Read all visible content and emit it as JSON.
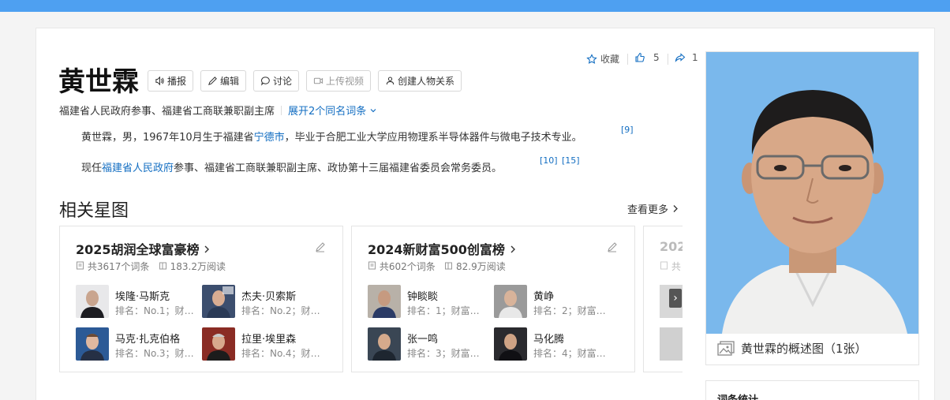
{
  "header": {
    "name": "黄世霖",
    "buttons": {
      "broadcast": "播报",
      "edit": "编辑",
      "discuss": "讨论",
      "upload_video": "上传视频",
      "create_relation": "创建人物关系"
    },
    "subtitle": "福建省人民政府参事、福建省工商联兼职副主席",
    "expand_label": "展开2个同名词条"
  },
  "actions": {
    "collect": "收藏",
    "like_count": "5",
    "share_count": "1"
  },
  "summary": {
    "para1_pre": "黄世霖，男，1967年10月生于福建省",
    "para1_link": "宁德市",
    "para1_post": "，毕业于合肥工业大学应用物理系半导体器件与微电子技术专业。",
    "para1_ref": "[9]",
    "para2_pre": "现任",
    "para2_link": "福建省人民政府",
    "para2_post": "参事、福建省工商联兼职副主席、政协第十三届福建省委员会常务委员。",
    "para2_ref1": "[10]",
    "para2_ref2": "[15]"
  },
  "related": {
    "title": "相关星图",
    "see_more": "查看更多",
    "cards": [
      {
        "title": "2025胡润全球富豪榜",
        "entries": "共3617个词条",
        "reads": "183.2万阅读",
        "people": [
          {
            "name": "埃隆·马斯克",
            "desc": "排名：No.1；财富：..."
          },
          {
            "name": "杰夫·贝索斯",
            "desc": "排名：No.2；财富：..."
          },
          {
            "name": "马克·扎克伯格",
            "desc": "排名：No.3；财富：..."
          },
          {
            "name": "拉里·埃里森",
            "desc": "排名：No.4；财富：..."
          }
        ]
      },
      {
        "title": "2024新财富500创富榜",
        "entries": "共602个词条",
        "reads": "82.9万阅读",
        "people": [
          {
            "name": "钟睒睒",
            "desc": "排名：1；财富：..."
          },
          {
            "name": "黄峥",
            "desc": "排名：2；财富：..."
          },
          {
            "name": "张一鸣",
            "desc": "排名：3；财富：..."
          },
          {
            "name": "马化腾",
            "desc": "排名：4；财富：..."
          }
        ]
      },
      {
        "title": "202",
        "meta": "共"
      }
    ]
  },
  "sidebar": {
    "photo_caption": "黄世霖的概述图（1张）",
    "stats_title": "词条统计"
  },
  "colors": {
    "link": "#136ec2",
    "topbar": "#4ea0f1",
    "photo_bg": "#7ab8ec"
  }
}
